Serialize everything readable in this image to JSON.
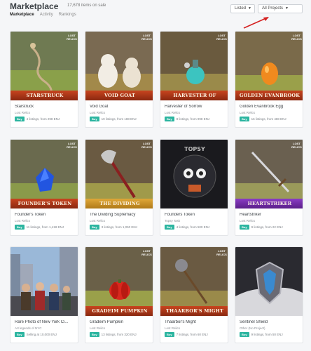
{
  "header": {
    "title": "Marketplace",
    "count": "17,678 items on sale",
    "tabs": [
      "Marketplace",
      "Activity",
      "Rankings"
    ],
    "listed_label": "Listed",
    "projects_label": "All Projects"
  },
  "badge": {
    "line1": "LOST",
    "line2": "RELICS"
  },
  "buy_label": "Buy",
  "cards": [
    {
      "banner": "Starstruck",
      "name": "Starstruck",
      "project": "Lost Relics",
      "listing": "4 listings, from 298 ENJ"
    },
    {
      "banner": "Void Goat",
      "name": "Void Goat",
      "project": "Lost Relics",
      "listing": "19 listings, from 188 ENJ"
    },
    {
      "banner": "Harvester of Sorrow",
      "name": "Harvester of Sorrow",
      "project": "Lost Relics",
      "listing": "8 listings, from 998 ENJ"
    },
    {
      "banner": "Golden Evanbrook Egg",
      "name": "Golden Evanbrook Egg",
      "project": "Lost Relics",
      "listing": "16 listings, from 488 ENJ"
    },
    {
      "banner": "Founder's Token",
      "name": "Founder's Token",
      "project": "Lost Relics",
      "listing": "11 listings, from 1,418 ENJ"
    },
    {
      "banner": "The Dividing Supremacy",
      "name": "The Dividing Supremacy",
      "project": "Lost Relics",
      "listing": "3 listings, from 1,050 ENJ"
    },
    {
      "banner": "",
      "name": "Founders Token",
      "project": "Topsy Task",
      "listing": "4 listings, from 500 ENJ"
    },
    {
      "banner": "Heartstriker",
      "name": "Heartstriker",
      "project": "Lost Relics",
      "listing": "9 listings, from 22 ENJ"
    },
    {
      "banner": "",
      "name": "Rare Photo of New York Ci...",
      "project": "Art legends of NYC",
      "listing": "Selling at 10,000 ENJ"
    },
    {
      "banner": "Gradeim Pumpkin",
      "name": "Gradeim Pumpkin",
      "project": "Lost Relics",
      "listing": "13 listings, from 320 ENJ"
    },
    {
      "banner": "Thaarbor's Might",
      "name": "Thaarbor's Might",
      "project": "Lost Relics",
      "listing": "7 listings, from 60 ENJ"
    },
    {
      "banner": "",
      "name": "Sentinel Shield",
      "project": "Other (No Project)",
      "listing": "9 listings, from 50 ENJ"
    }
  ]
}
